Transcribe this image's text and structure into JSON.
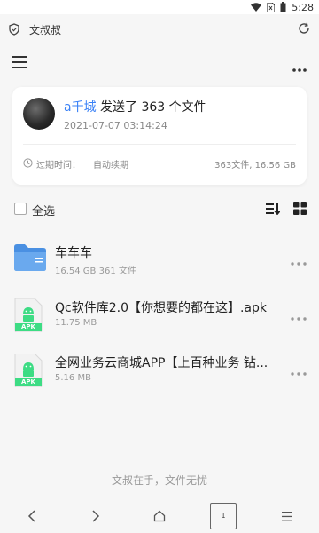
{
  "status_bar": {
    "time": "5:28"
  },
  "app": {
    "title": "文叔叔"
  },
  "share": {
    "sender_name": "a千城",
    "sent_text": " 发送了 363 个文件",
    "sent_time": "2021-07-07 03:14:24",
    "expire_label": "过期时间：",
    "expire_value": "自动续期",
    "summary": "363文件, 16.56 GB"
  },
  "toolbar": {
    "select_all_label": "全选"
  },
  "files": [
    {
      "name": "车车车",
      "meta": "16.54 GB 361 文件",
      "icon": "folder-icon"
    },
    {
      "name": "Qc软件库2.0【你想要的都在这】.apk",
      "meta": "11.75 MB",
      "icon": "apk-icon",
      "badge": "APK"
    },
    {
      "name": "全网业务云商城APP【上百种业务 钻...",
      "meta": "5.16 MB",
      "icon": "apk-icon",
      "badge": "APK"
    }
  ],
  "footer": {
    "slogan": "文叔在手，文件无忧"
  },
  "browser_nav": {
    "tab_count": "1"
  },
  "colors": {
    "accent": "#3b82f6",
    "folder": "#4a90e2",
    "apk": "#3ddc84"
  }
}
